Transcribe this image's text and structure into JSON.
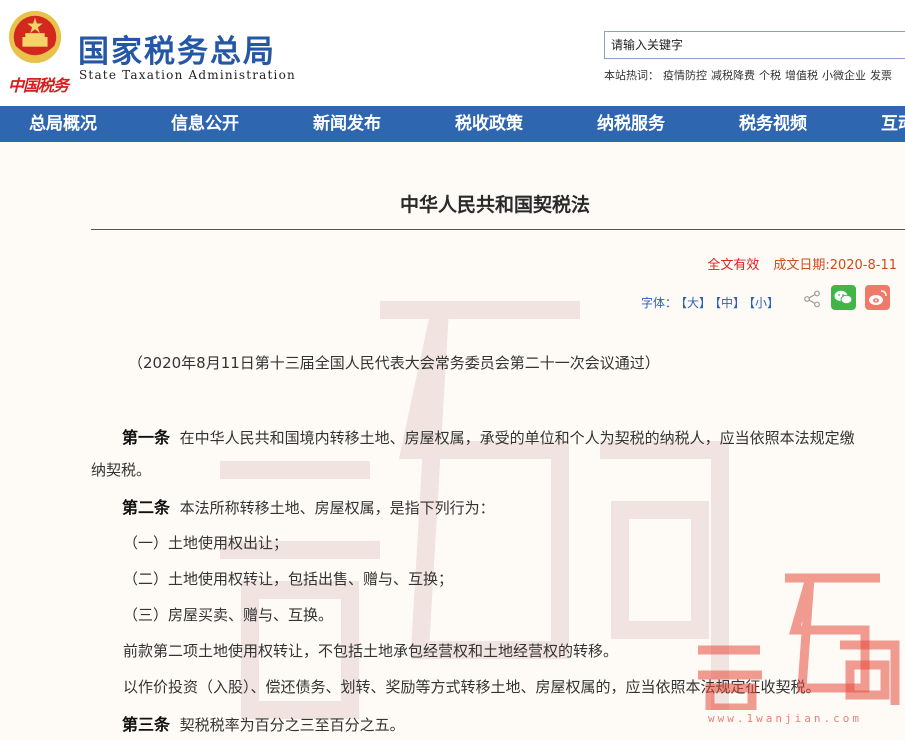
{
  "header": {
    "emblem_icon": "national-emblem-icon",
    "brand_script": "中国税务",
    "title": "国家税务总局",
    "subtitle": "State Taxation Administration",
    "search_placeholder": "请输入关键字",
    "hot_label": "本站热词：",
    "hot_words": [
      "疫情防控",
      "减税降费",
      "个税",
      "增值税",
      "小微企业",
      "发票"
    ]
  },
  "nav": {
    "items": [
      "总局概况",
      "信息公开",
      "新闻发布",
      "税收政策",
      "纳税服务",
      "税务视频",
      "互动"
    ]
  },
  "article": {
    "title": "中华人民共和国契税法",
    "validity": "全文有效",
    "date": "成文日期:2020-8-11",
    "font_label": "字体：",
    "font_large": "【大】",
    "font_medium": "【中】",
    "font_small": "【小】",
    "preamble": "（2020年8月11日第十三届全国人民代表大会常务委员会第二十一次会议通过）",
    "art1_head": "第一条",
    "art1_line1": "在中华人民共和国境内转移土地、房屋权属，承受的单位和个人为契税的纳税人，应当依照本法规定缴",
    "art1_line2": "纳契税。",
    "art2_head": "第二条",
    "art2_text": "本法所称转移土地、房屋权属，是指下列行为：",
    "item1": "（一）土地使用权出让；",
    "item2": "（二）土地使用权转让，包括出售、赠与、互换；",
    "item3": "（三）房屋买卖、赠与、互换。",
    "para1": "前款第二项土地使用权转让，不包括土地承包经营权和土地经营权的转移。",
    "para2": "以作价投资（入股）、偿还债务、划转、奖励等方式转移土地、房屋权属的，应当依照本法规定征收契税。",
    "art3_head": "第三条",
    "art3_text": "契税税率为百分之三至百分之五。"
  },
  "watermark": {
    "text": "壹万间",
    "url": "www.1wanjian.com"
  }
}
